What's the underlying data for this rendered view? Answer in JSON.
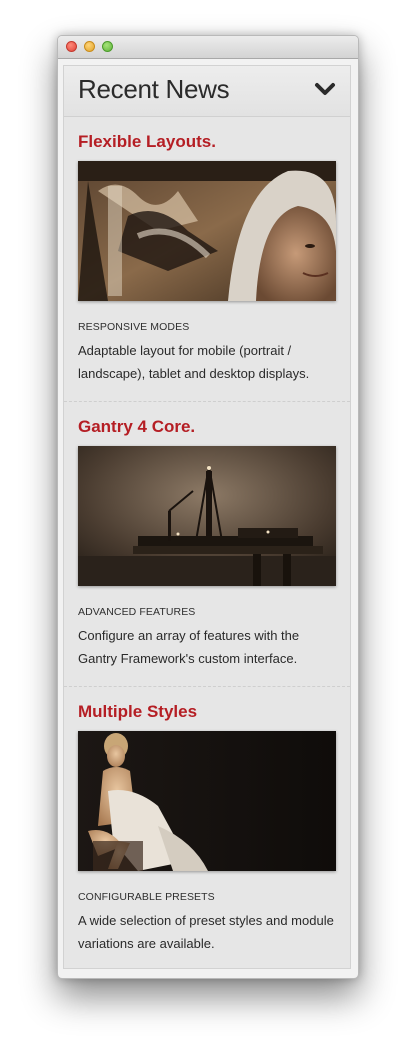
{
  "window": {
    "controls": [
      "close",
      "minimize",
      "zoom"
    ]
  },
  "module": {
    "title": "Recent News",
    "toggle_icon": "chevron-down-icon"
  },
  "articles": [
    {
      "title": "Flexible Layouts.",
      "image": "graffiti-hoodie-portrait",
      "subtitle": "RESPONSIVE MODES",
      "description": "Adaptable layout for mobile (portrait / landscape), tablet and desktop displays."
    },
    {
      "title": "Gantry 4 Core.",
      "image": "offshore-oil-rig",
      "subtitle": "ADVANCED FEATURES",
      "description": "Configure an array of features with the Gantry Framework's custom interface."
    },
    {
      "title": "Multiple Styles",
      "image": "seated-woman-portrait",
      "subtitle": "CONFIGURABLE PRESETS",
      "description": "A wide selection of preset styles and module variations are available."
    }
  ],
  "colors": {
    "accent": "#b51e24",
    "panel_bg": "#e6e6e6",
    "text": "#2a2a2a"
  }
}
